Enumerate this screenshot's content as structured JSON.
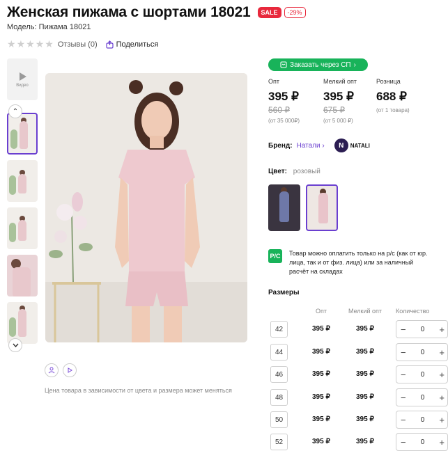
{
  "product": {
    "title": "Женская пижама с шортами 18021",
    "sale_badge": "SALE",
    "discount_badge": "-29%",
    "model": "Модель: Пижама 18021",
    "reviews": "Отзывы (0)",
    "share": "Поделиться"
  },
  "gallery": {
    "video_label": "Видео",
    "price_note": "Цена товара в зависимости от цвета и размера может меняться"
  },
  "order_button": "Заказать через СП",
  "prices": [
    {
      "label": "Опт",
      "value": "395 ₽",
      "old": "560 ₽",
      "note": "(от 35 000₽)"
    },
    {
      "label": "Мелкий опт",
      "value": "395 ₽",
      "old": "675 ₽",
      "note": "(от 5 000 ₽)"
    },
    {
      "label": "Розница",
      "value": "688 ₽",
      "old": "",
      "note": "(от 1 товара)"
    }
  ],
  "brand": {
    "label": "Бренд:",
    "link": "Натали",
    "logo_text": "N",
    "logo_name": "NATALI"
  },
  "color": {
    "label": "Цвет:",
    "value": "розовый"
  },
  "payment": {
    "icon_text": "P/C",
    "text": "Товар можно оплатить только на р/с (как от юр. лица, так и от физ. лица) или за наличный расчёт на складах"
  },
  "sizes": {
    "title": "Размеры",
    "headers": [
      "Опт",
      "Мелкий опт",
      "Количество"
    ],
    "rows": [
      {
        "size": "42",
        "opt": "395 ₽",
        "small_opt": "395 ₽",
        "qty": "0"
      },
      {
        "size": "44",
        "opt": "395 ₽",
        "small_opt": "395 ₽",
        "qty": "0"
      },
      {
        "size": "46",
        "opt": "395 ₽",
        "small_opt": "395 ₽",
        "qty": "0"
      },
      {
        "size": "48",
        "opt": "395 ₽",
        "small_opt": "395 ₽",
        "qty": "0"
      },
      {
        "size": "50",
        "opt": "395 ₽",
        "small_opt": "395 ₽",
        "qty": "0"
      },
      {
        "size": "52",
        "opt": "395 ₽",
        "small_opt": "395 ₽",
        "qty": "0"
      }
    ]
  },
  "colors": {
    "accent": "#6a3fd0",
    "sale": "#e8283c",
    "green": "#18b35a"
  }
}
